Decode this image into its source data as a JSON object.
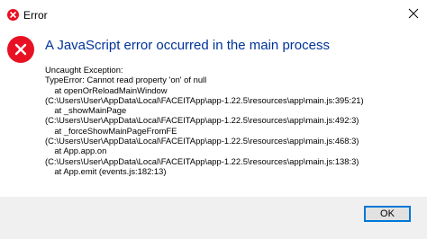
{
  "window": {
    "title": "Error"
  },
  "dialog": {
    "headline": "A JavaScript error occurred in the main process",
    "details": [
      "Uncaught Exception:",
      "TypeError: Cannot read property 'on' of null",
      "    at openOrReloadMainWindow",
      "(C:\\Users\\User\\AppData\\Local\\FACEITApp\\app-1.22.5\\resources\\app\\main.js:395:21)",
      "    at _showMainPage",
      "(C:\\Users\\User\\AppData\\Local\\FACEITApp\\app-1.22.5\\resources\\app\\main.js:492:3)",
      "    at _forceShowMainPageFromFE",
      "(C:\\Users\\User\\AppData\\Local\\FACEITApp\\app-1.22.5\\resources\\app\\main.js:468:3)",
      "    at App.app.on",
      "(C:\\Users\\User\\AppData\\Local\\FACEITApp\\app-1.22.5\\resources\\app\\main.js:138:3)",
      "    at App.emit (events.js:182:13)"
    ],
    "ok_label": "OK"
  },
  "icons": {
    "title_icon": "error-x-icon",
    "close_icon": "close-icon",
    "main_icon": "error-x-icon"
  },
  "colors": {
    "error_red": "#e81123",
    "headline_blue": "#003399",
    "accent_blue": "#0078d7",
    "footer_gray": "#f0f0f0"
  }
}
